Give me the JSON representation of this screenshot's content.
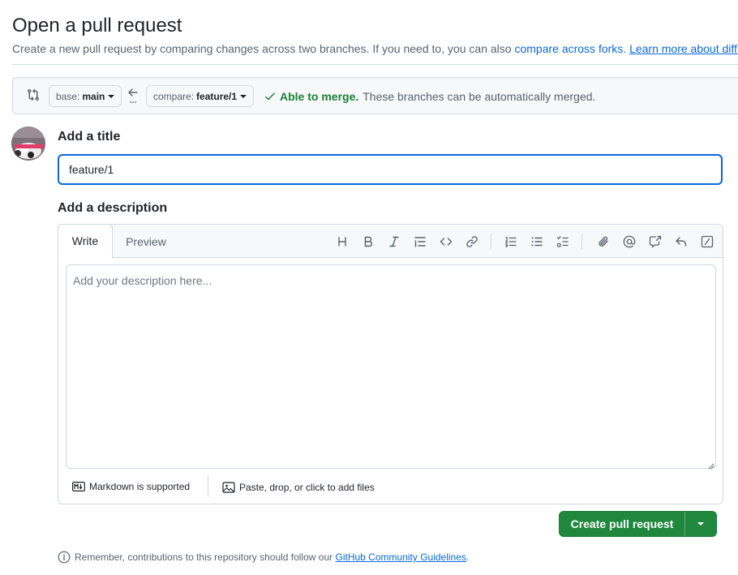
{
  "header": {
    "title": "Open a pull request",
    "subtitle_text": "Create a new pull request by comparing changes across two branches. If you need to, you can also",
    "compare_forks_link": "compare across forks.",
    "learn_more_link": "Learn more about diff comparisons here."
  },
  "compare": {
    "base_prefix": "base:",
    "base_branch": "main",
    "compare_prefix": "compare:",
    "compare_branch": "feature/1",
    "merge_status": "Able to merge.",
    "merge_detail": "These branches can be automatically merged."
  },
  "form": {
    "title_label": "Add a title",
    "title_value": "feature/1",
    "description_label": "Add a description",
    "description_placeholder": "Add your description here...",
    "tabs": [
      "Write",
      "Preview"
    ],
    "markdown_note": "Markdown is supported",
    "files_note": "Paste, drop, or click to add files"
  },
  "toolbar": {
    "icons": [
      "heading-icon",
      "bold-icon",
      "italic-icon",
      "quote-icon",
      "code-icon",
      "link-icon",
      "numbered-list-icon",
      "unordered-list-icon",
      "task-list-icon",
      "attach-icon",
      "mention-icon",
      "cross-reference-icon",
      "reply-icon",
      "slash-commands-icon"
    ]
  },
  "actions": {
    "create_label": "Create pull request"
  },
  "footer": {
    "notice_text": "Remember, contributions to this repository should follow our",
    "guidelines_link": "GitHub Community Guidelines",
    "period": "."
  },
  "colors": {
    "primary_green": "#1f883d",
    "link_blue": "#0969da",
    "success_green": "#1a7f37",
    "border": "#d1d9e0"
  }
}
